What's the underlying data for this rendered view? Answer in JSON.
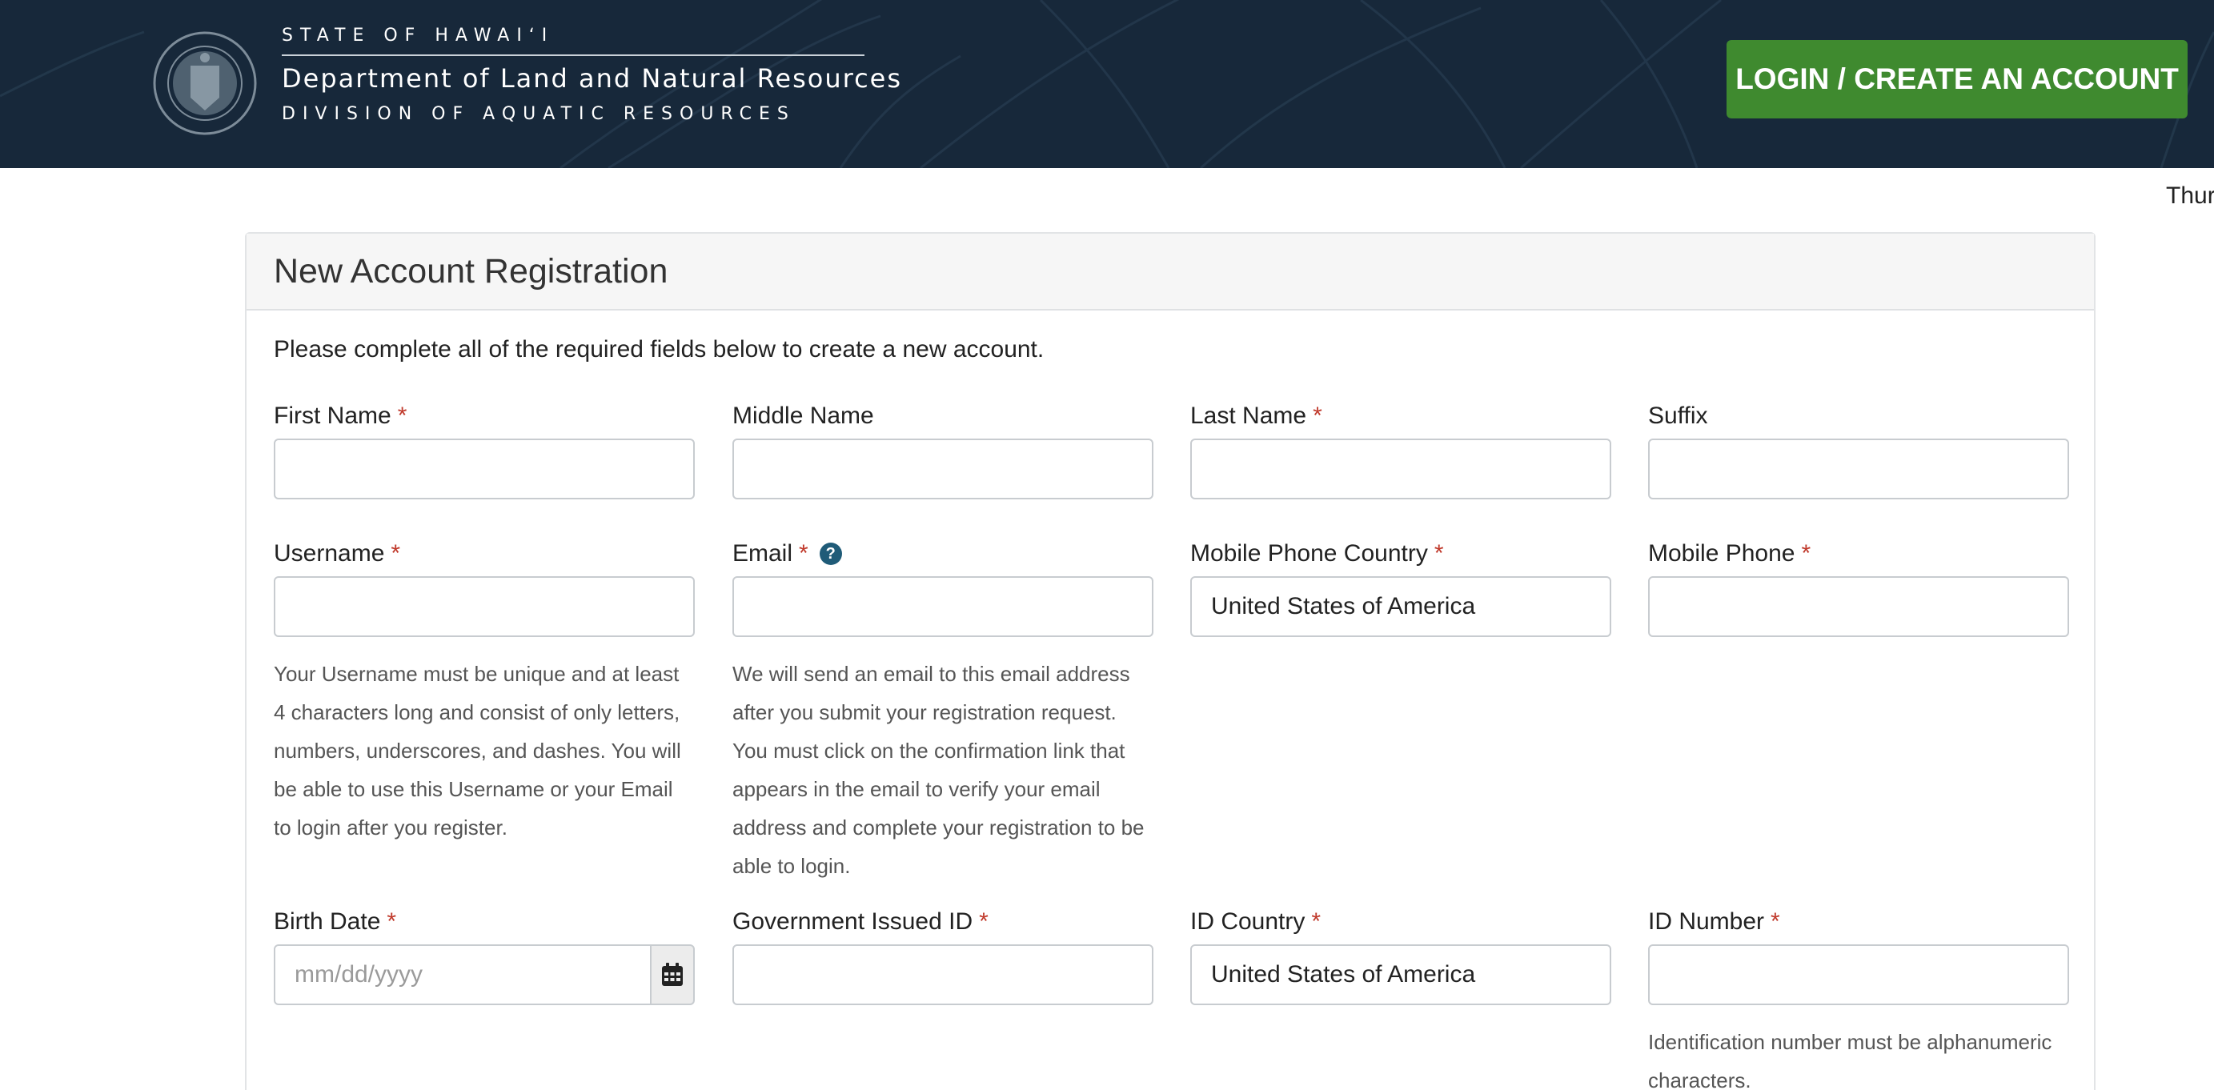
{
  "header": {
    "state": "STATE OF HAWAIʻI",
    "department": "Department of Land and Natural Resources",
    "division": "DIVISION OF AQUATIC RESOURCES",
    "login_button": "LOGIN / CREATE AN ACCOUNT",
    "date_partial": "Thur"
  },
  "colors": {
    "header_bg": "#17283a",
    "login_button_bg": "#3f8a2f",
    "required_star": "#c0392b",
    "help_icon": "#1f5b78"
  },
  "form": {
    "title": "New Account Registration",
    "intro": "Please complete all of the required fields below to create a new account.",
    "required_mark": "*",
    "fields": {
      "first_name": {
        "label": "First Name",
        "value": ""
      },
      "middle_name": {
        "label": "Middle Name",
        "value": ""
      },
      "last_name": {
        "label": "Last Name",
        "value": ""
      },
      "suffix": {
        "label": "Suffix",
        "value": ""
      },
      "username": {
        "label": "Username",
        "value": "",
        "hint": "Your Username must be unique and at least 4 characters long and consist of only letters, numbers, underscores, and dashes. You will be able to use this Username or your Email to login after you register."
      },
      "email": {
        "label": "Email",
        "help_icon": "?",
        "value": "",
        "hint": "We will send an email to this email address after you submit your registration request. You must click on the confirmation link that appears in the email to verify your email address and complete your registration to be able to login."
      },
      "mobile_phone_country": {
        "label": "Mobile Phone Country",
        "value": "United States of America"
      },
      "mobile_phone": {
        "label": "Mobile Phone",
        "value": ""
      },
      "birth_date": {
        "label": "Birth Date",
        "placeholder": "mm/dd/yyyy",
        "value": "",
        "icon": "calendar-icon"
      },
      "government_id": {
        "label": "Government Issued ID",
        "value": ""
      },
      "id_country": {
        "label": "ID Country",
        "value": "United States of America"
      },
      "id_number": {
        "label": "ID Number",
        "value": "",
        "hint": "Identification number must be alphanumeric characters."
      }
    }
  }
}
